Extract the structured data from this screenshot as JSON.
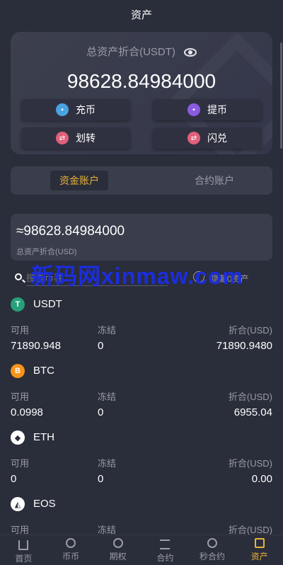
{
  "header": {
    "title": "资产"
  },
  "summary": {
    "label": "总资产折合(USDT)",
    "total": "98628.84984000",
    "actions": [
      {
        "label": "充币",
        "icon": "deposit-icon",
        "color": "#4aa3e0"
      },
      {
        "label": "提币",
        "icon": "withdraw-icon",
        "color": "#8a5be0"
      },
      {
        "label": "划转",
        "icon": "transfer-icon",
        "color": "#e0607a"
      },
      {
        "label": "闪兑",
        "icon": "flash-exchange-icon",
        "color": "#e0607a"
      }
    ]
  },
  "tabs": [
    {
      "label": "资金账户",
      "active": true
    },
    {
      "label": "合约账户",
      "active": false
    }
  ],
  "account": {
    "value": "≈98628.84984000",
    "label": "总资产折合(USD)"
  },
  "search": {
    "placeholder": "搜索币种",
    "hide_label": "隐藏0资产"
  },
  "watermark": "新码网xinmaw.com",
  "columns": {
    "available": "可用",
    "frozen": "冻结",
    "converted": "折合(USD)"
  },
  "assets": [
    {
      "name": "USDT",
      "icon_color": "#26a17b",
      "glyph": "T",
      "available": "71890.948",
      "frozen": "0",
      "converted": "71890.9480"
    },
    {
      "name": "BTC",
      "icon_color": "#f7931a",
      "glyph": "B",
      "available": "0.0998",
      "frozen": "0",
      "converted": "6955.04"
    },
    {
      "name": "ETH",
      "icon_color": "#ffffff",
      "glyph": "◆",
      "available": "0",
      "frozen": "0",
      "converted": "0.00"
    },
    {
      "name": "EOS",
      "icon_color": "#ffffff",
      "glyph": "◭",
      "available": "",
      "frozen": "",
      "converted": ""
    }
  ],
  "nav": [
    {
      "label": "首页",
      "icon": "home-icon",
      "active": false
    },
    {
      "label": "币币",
      "icon": "spot-icon",
      "active": false
    },
    {
      "label": "期权",
      "icon": "options-icon",
      "active": false
    },
    {
      "label": "合约",
      "icon": "contract-icon",
      "active": false
    },
    {
      "label": "秒合约",
      "icon": "second-contract-icon",
      "active": false
    },
    {
      "label": "资产",
      "icon": "assets-icon",
      "active": true
    }
  ],
  "colors": {
    "accent": "#e8b339",
    "background": "#2a2d3a",
    "card": "#3a3d4b"
  }
}
